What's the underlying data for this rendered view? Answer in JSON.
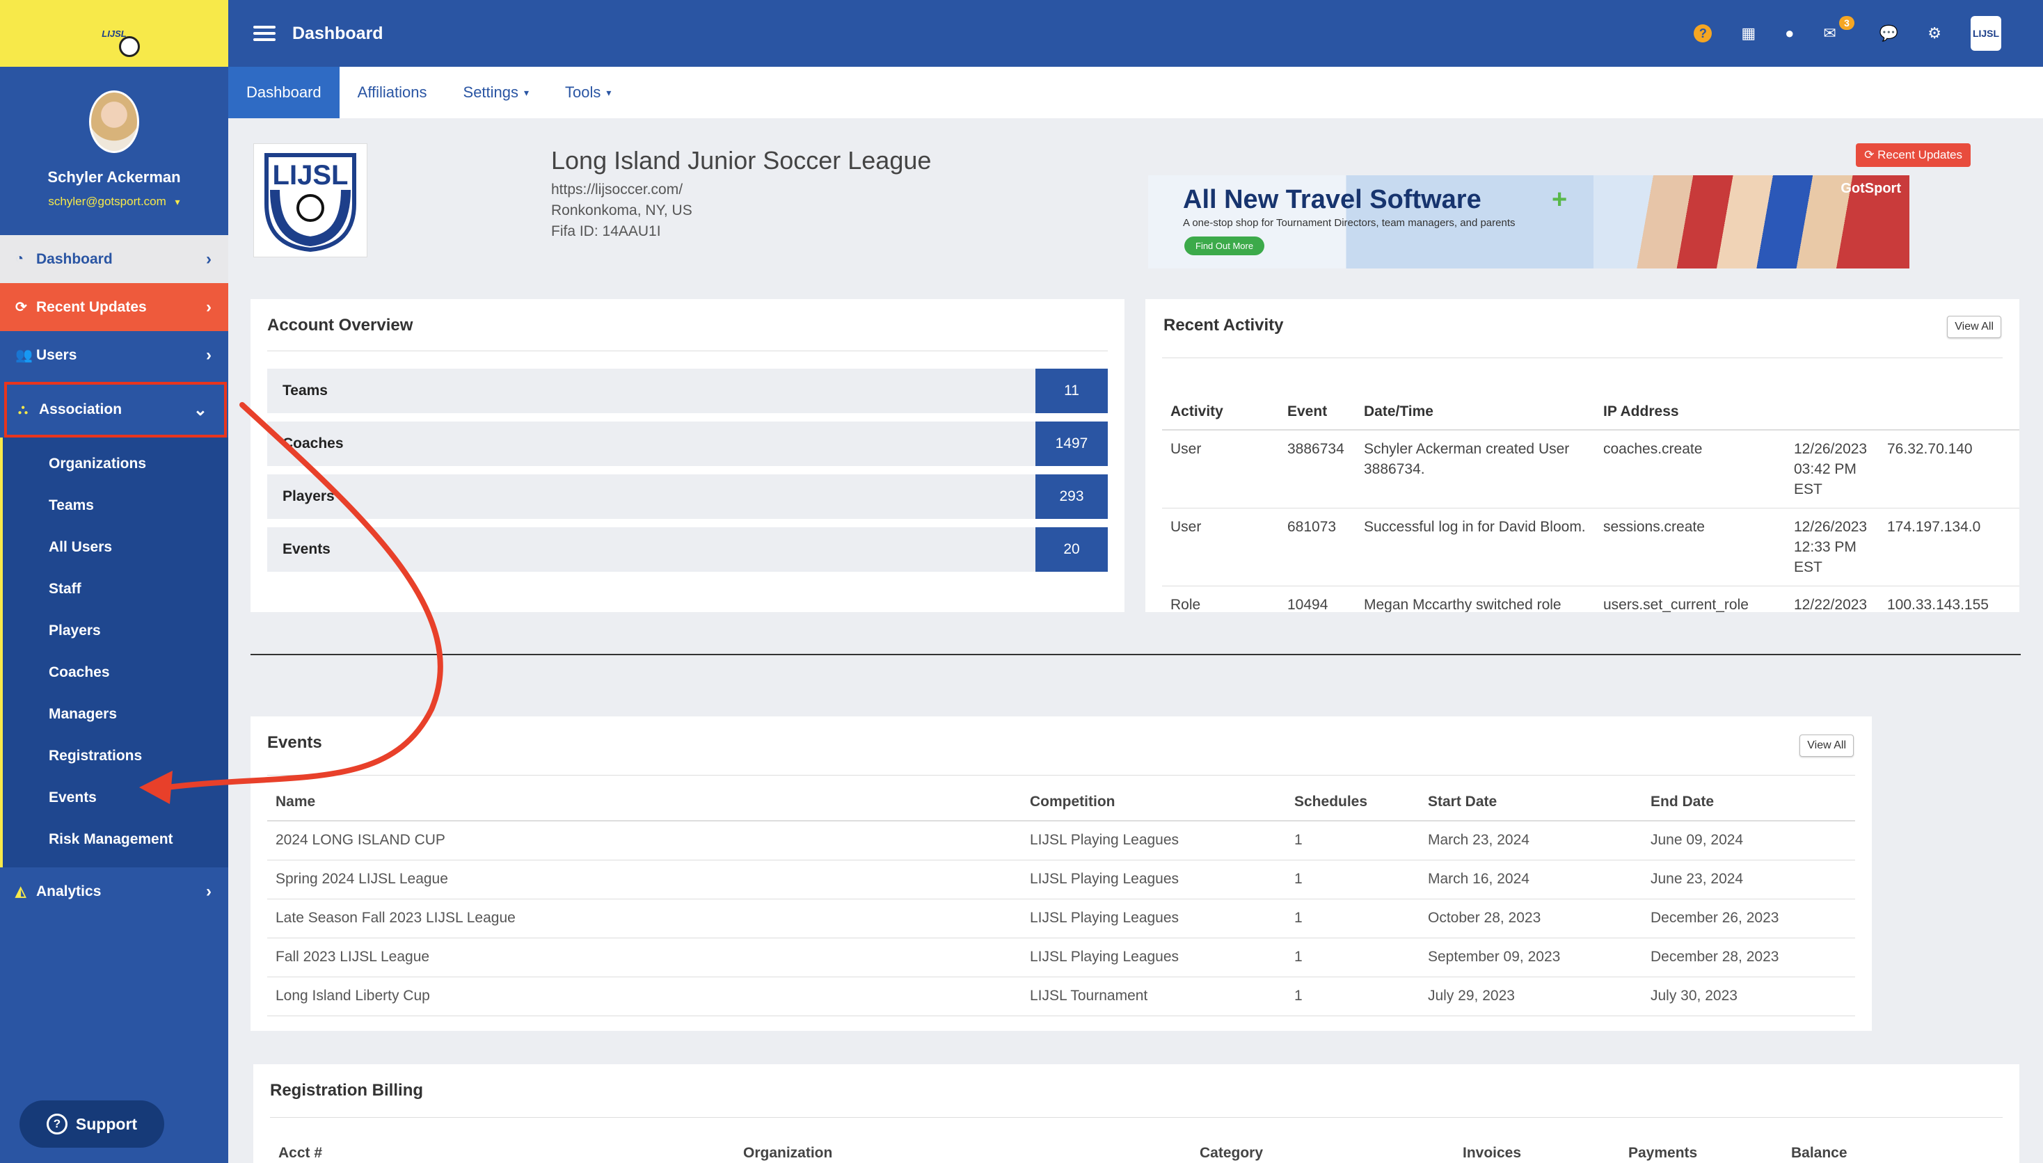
{
  "sidebar": {
    "logo_text": "LIJSL",
    "user": {
      "name": "Schyler Ackerman",
      "email": "schyler@gotsport.com"
    },
    "nav": {
      "dashboard": "Dashboard",
      "recent_updates": "Recent Updates",
      "users": "Users",
      "association": "Association",
      "analytics": "Analytics"
    },
    "association_items": [
      "Organizations",
      "Teams",
      "All Users",
      "Staff",
      "Players",
      "Coaches",
      "Managers",
      "Registrations",
      "Events",
      "Risk Management"
    ],
    "support_label": "Support"
  },
  "topbar": {
    "title": "Dashboard",
    "mail_count": "3",
    "logo_text": "LIJSL",
    "icons": [
      "help-icon",
      "qr-icon",
      "user-icon",
      "mail-icon",
      "chat-icon",
      "gear-icon"
    ]
  },
  "subnav": {
    "tabs": [
      "Dashboard",
      "Affiliations",
      "Settings",
      "Tools"
    ],
    "active": "Dashboard"
  },
  "org": {
    "name": "Long Island Junior Soccer League",
    "url": "https://lijsoccer.com/",
    "location": "Ronkonkoma, NY, US",
    "fifa": "Fifa ID: 14AAU1I",
    "logo_text": "LIJSL"
  },
  "recent_updates_button": "Recent Updates",
  "banner": {
    "title": "All New Travel Software",
    "subtitle": "A one-stop shop for Tournament Directors, team managers, and parents",
    "button": "Find Out More",
    "brand": "GotSport"
  },
  "account_overview": {
    "title": "Account Overview",
    "rows": [
      {
        "label": "Teams",
        "value": "11"
      },
      {
        "label": "Coaches",
        "value": "1497"
      },
      {
        "label": "Players",
        "value": "293"
      },
      {
        "label": "Events",
        "value": "20"
      }
    ]
  },
  "recent_activity": {
    "title": "Recent Activity",
    "view_all": "View All",
    "columns": [
      "Activity",
      "Event",
      "Date/Time",
      "IP Address",
      "",
      ""
    ],
    "rows": [
      [
        "User",
        "3886734",
        "Schyler Ackerman created User 3886734.",
        "coaches.create",
        "12/26/2023 03:42 PM EST",
        "76.32.70.140"
      ],
      [
        "User",
        "681073",
        "Successful log in for David Bloom.",
        "sessions.create",
        "12/26/2023 12:33 PM EST",
        "174.197.134.0"
      ],
      [
        "Role",
        "10494",
        "Megan Mccarthy switched role",
        "users.set_current_role",
        "12/22/2023",
        "100.33.143.155"
      ]
    ]
  },
  "events": {
    "title": "Events",
    "view_all": "View All",
    "columns": [
      "Name",
      "Competition",
      "Schedules",
      "Start Date",
      "End Date"
    ],
    "rows": [
      [
        "2024 LONG ISLAND CUP",
        "LIJSL Playing Leagues",
        "1",
        "March 23, 2024",
        "June 09, 2024"
      ],
      [
        "Spring 2024 LIJSL League",
        "LIJSL Playing Leagues",
        "1",
        "March 16, 2024",
        "June 23, 2024"
      ],
      [
        "Late Season Fall 2023 LIJSL League",
        "LIJSL Playing Leagues",
        "1",
        "October 28, 2023",
        "December 26, 2023"
      ],
      [
        "Fall 2023 LIJSL League",
        "LIJSL Playing Leagues",
        "1",
        "September 09, 2023",
        "December 28, 2023"
      ],
      [
        "Long Island Liberty Cup",
        "LIJSL Tournament",
        "1",
        "July 29, 2023",
        "July 30, 2023"
      ]
    ]
  },
  "registration_billing": {
    "title": "Registration Billing",
    "columns": [
      "Acct #",
      "Organization",
      "Category",
      "Invoices",
      "Payments",
      "Balance"
    ]
  }
}
